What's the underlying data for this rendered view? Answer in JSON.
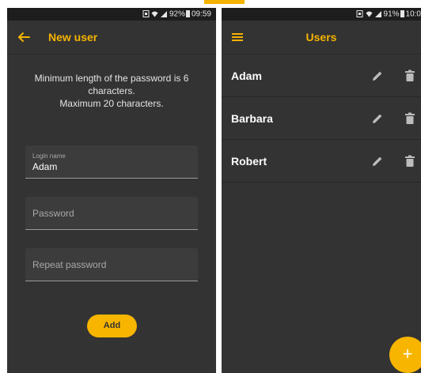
{
  "colors": {
    "accent": "#f5b300",
    "background": "#333333",
    "status_bar": "#1d1d1d",
    "field_background": "#3c3c3c"
  },
  "left_screen": {
    "status_bar": {
      "battery": "92%",
      "time": "09:59"
    },
    "app_bar": {
      "back_icon": "arrow-left-icon",
      "title": "New user"
    },
    "info_line1": "Minimum length of the password is 6",
    "info_line2": "characters.",
    "info_line3": "Maximum 20 characters.",
    "login_field": {
      "label": "Login name",
      "value": "Adam"
    },
    "password_field": {
      "placeholder": "Password"
    },
    "repeat_password_field": {
      "placeholder": "Repeat password"
    },
    "add_button_label": "Add"
  },
  "right_screen": {
    "status_bar": {
      "battery": "91%",
      "time": "10:0"
    },
    "app_bar": {
      "menu_icon": "hamburger-menu-icon",
      "title": "Users"
    },
    "users": [
      {
        "name": "Adam"
      },
      {
        "name": "Barbara"
      },
      {
        "name": "Robert"
      }
    ],
    "row_icons": {
      "edit": "pencil-icon",
      "delete": "trash-icon"
    },
    "fab_label": "+"
  }
}
